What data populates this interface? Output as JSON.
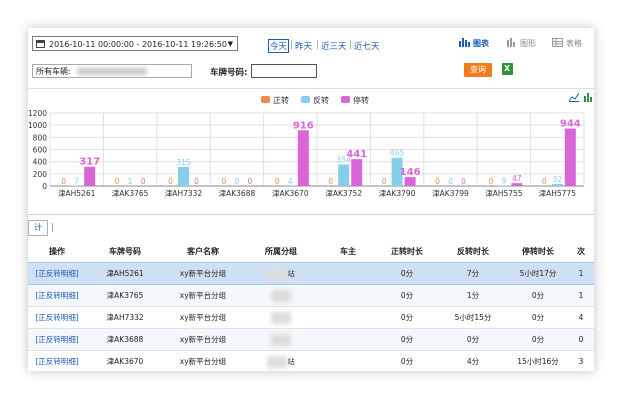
{
  "filters": {
    "date_range": "2016-10-11 00:00:00 - 2016-10-11 19:26:50",
    "quick_ranges": [
      "今天",
      "昨天",
      "近三天",
      "近七天"
    ],
    "vehicle_select": "所有车辆:",
    "plate_label": "车牌号码:",
    "plate_value": "",
    "query_label": "查询"
  },
  "views": [
    "图表",
    "图形",
    "表格"
  ],
  "chart_data": {
    "type": "bar",
    "categories": [
      "津AH5261",
      "津AK3765",
      "津AH7332",
      "津AK3688",
      "津AK3670",
      "津AK3752",
      "津AK3790",
      "津AK3799",
      "津AH5755",
      "津AH5775"
    ],
    "series": [
      {
        "name": "正转",
        "color": "#f08a4c",
        "values": [
          0,
          0,
          0,
          0,
          0,
          0,
          0,
          0,
          0,
          0
        ]
      },
      {
        "name": "反转",
        "color": "#87ceeb",
        "values": [
          7,
          1,
          315,
          0,
          4,
          354,
          465,
          0,
          9,
          32
        ]
      },
      {
        "name": "停转",
        "color": "#d966d6",
        "values": [
          317,
          0,
          0,
          0,
          916,
          441,
          146,
          0,
          47,
          944
        ]
      }
    ],
    "ylim": [
      0,
      1200
    ],
    "yticks": [
      0,
      200,
      400,
      600,
      800,
      1000,
      1200
    ],
    "legend_position": "top-center",
    "grid": true
  },
  "tabs": {
    "stats_label": "计"
  },
  "table": {
    "columns": [
      "操作",
      "车牌号码",
      "客户名称",
      "所属分组",
      "车主",
      "正转时长",
      "反转时长",
      "停转时长",
      "次"
    ],
    "rows": [
      {
        "action": "[正反转明细]",
        "plate": "津AH5261",
        "customer": "xy新平台分组",
        "group": "站",
        "owner": "",
        "forward": "0分",
        "reverse": "7分",
        "stopped": "5小时17分",
        "count": "1"
      },
      {
        "action": "[正反转明细]",
        "plate": "津AK3765",
        "customer": "xy新平台分组",
        "group": "",
        "owner": "",
        "forward": "0分",
        "reverse": "1分",
        "stopped": "0分",
        "count": "1"
      },
      {
        "action": "[正反转明细]",
        "plate": "津AH7332",
        "customer": "xy新平台分组",
        "group": "",
        "owner": "",
        "forward": "0分",
        "reverse": "5小时15分",
        "stopped": "0分",
        "count": "4"
      },
      {
        "action": "[正反转明细]",
        "plate": "津AK3688",
        "customer": "xy新平台分组",
        "group": "",
        "owner": "",
        "forward": "0分",
        "reverse": "0分",
        "stopped": "0分",
        "count": "0"
      },
      {
        "action": "[正反转明细]",
        "plate": "津AK3670",
        "customer": "xy新平台分组",
        "group": "站",
        "owner": "",
        "forward": "0分",
        "reverse": "4分",
        "stopped": "15小时16分",
        "count": "3"
      }
    ]
  }
}
